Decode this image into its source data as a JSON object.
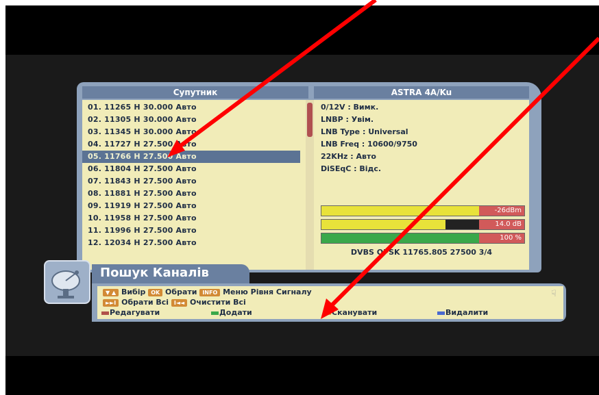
{
  "left_header": "Супутник",
  "right_header": "ASTRA 4A/Ku",
  "transponders": [
    "01. 11265 H 30.000 Авто",
    "02. 11305 H 30.000 Авто",
    "03. 11345 H 30.000 Авто",
    "04. 11727 H 27.500 Авто",
    "05. 11766 H 27.500 Авто",
    "06. 11804 H 27.500 Авто",
    "07. 11843 H 27.500 Авто",
    "08. 11881 H 27.500 Авто",
    "09. 11919 H 27.500 Авто",
    "10. 11958 H 27.500 Авто",
    "11. 11996 H 27.500 Авто",
    "12. 12034 H 27.500 Авто"
  ],
  "selected_index": 4,
  "info": [
    "0/12V : Вимк.",
    "LNBP : Увім.",
    "LNB Type : Universal",
    "LNB Freq : 10600/9750",
    "22KHz : Авто",
    "DiSEqC : Відс."
  ],
  "signal": {
    "level": "-26dBm",
    "quality": "14.0  dB",
    "lock": "100  %",
    "level_fraction": 0.8,
    "quality_fraction": 0.61,
    "lock_fraction": 1.0
  },
  "dvbs_line": "DVBS QPSK  11765.805  27500  3/4",
  "title": "Пошук Каналів",
  "help": {
    "chip_updown": "▼ ▲",
    "select": "Вибір",
    "chip_ok": "OK",
    "choose": "Обрати",
    "chip_info": "INFO",
    "menu": "Меню",
    "signal": "Рівня Сигналу",
    "chip_next": "►►I",
    "choose_all": "Обрати Всі",
    "chip_prev": "I◄◄",
    "clear_all": "Очистити Всі",
    "red": "Редагувати",
    "green": "Додати",
    "yellow": "Сканувати",
    "blue": "Видалити"
  },
  "colors": {
    "red": "#b0524a",
    "green": "#3aa84a",
    "yellow": "#d6b43a",
    "blue": "#4a6ad0",
    "arrow": "#ff0000"
  }
}
